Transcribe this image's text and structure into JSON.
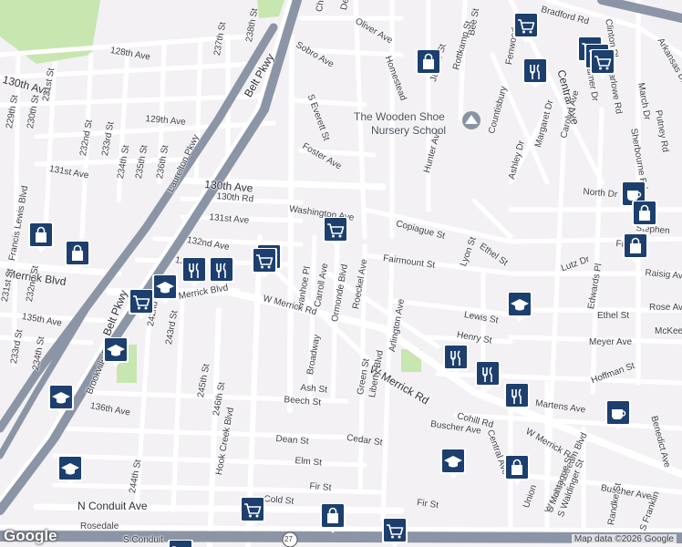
{
  "map": {
    "attribution": "Map data ©2026 Google",
    "logo_text": "Google",
    "route_shield": "27",
    "colors": {
      "bg": "#f3f1f4",
      "highway": "#8c95a5",
      "road": "#ffffff",
      "park": "#c8e6b0",
      "pin": "#1c3f6e"
    }
  },
  "streets": [
    {
      "text": "Charles"
    },
    {
      "text": "Dewitt St"
    },
    {
      "text": "Oliver Ave"
    },
    {
      "text": "Bee St"
    },
    {
      "text": "Bradford Rd"
    },
    {
      "text": "Clinton Pl"
    },
    {
      "text": "Fenwood"
    },
    {
      "text": "Sobro Ave"
    },
    {
      "text": "Homestead"
    },
    {
      "text": "Jasper St"
    },
    {
      "text": "Rottkamp St"
    },
    {
      "text": "Central Ave"
    },
    {
      "text": "Warner Dr"
    },
    {
      "text": "Barlowe Rd"
    },
    {
      "text": "March Dr"
    },
    {
      "text": "Putney Rd"
    },
    {
      "text": "Arkansas Dr"
    },
    {
      "text": "128th Ave"
    },
    {
      "text": "237th St"
    },
    {
      "text": "238th St"
    },
    {
      "text": "130th Ave"
    },
    {
      "text": "129th Ave"
    },
    {
      "text": "S Everett St"
    },
    {
      "text": "Belt Pkwy"
    },
    {
      "text": "Laurelton Pkwy"
    },
    {
      "text": "229th St"
    },
    {
      "text": "230th St"
    },
    {
      "text": "231st St"
    },
    {
      "text": "232nd St"
    },
    {
      "text": "233rd St"
    },
    {
      "text": "234th St"
    },
    {
      "text": "235th St"
    },
    {
      "text": "236th St"
    },
    {
      "text": "131st Ave"
    },
    {
      "text": "Francis Lewis Blvd"
    },
    {
      "text": "Foster Ave"
    },
    {
      "text": "Countisbury"
    },
    {
      "text": "Margaret Dr"
    },
    {
      "text": "Carolyn Ave"
    },
    {
      "text": "Sherbourne Rd"
    },
    {
      "text": "Ashley Dr"
    },
    {
      "text": "Hunter Ave"
    },
    {
      "text": "130th Ave"
    },
    {
      "text": "130th Rd"
    },
    {
      "text": "131st Ave"
    },
    {
      "text": "Washington Ave"
    },
    {
      "text": "North Dr"
    },
    {
      "text": "Copiague St"
    },
    {
      "text": "Stephen"
    },
    {
      "text": "Fritchie"
    },
    {
      "text": "132nd Ave"
    },
    {
      "text": "133rd"
    },
    {
      "text": "Merrick Blvd"
    },
    {
      "text": "Fairmount St"
    },
    {
      "text": "Lyon St"
    },
    {
      "text": "Ethel St"
    },
    {
      "text": "Lutz Dr"
    },
    {
      "text": "Raisig Ave"
    },
    {
      "text": "231st St"
    },
    {
      "text": "232nd St"
    },
    {
      "text": "Belt Pkwy"
    },
    {
      "text": "Ivanhoe Pl"
    },
    {
      "text": "Carroll Ave"
    },
    {
      "text": "Ormonde Blvd"
    },
    {
      "text": "Roeckel Ave"
    },
    {
      "text": "Arlington Ave"
    },
    {
      "text": "Edwards Pl"
    },
    {
      "text": "Rose Ave"
    },
    {
      "text": "Merrick Blvd"
    },
    {
      "text": "W Merrick Rd"
    },
    {
      "text": "135th Ave"
    },
    {
      "text": "242nd St"
    },
    {
      "text": "243rd St"
    },
    {
      "text": "Lewis St"
    },
    {
      "text": "Ethel St"
    },
    {
      "text": "McKee"
    },
    {
      "text": "233rd St"
    },
    {
      "text": "234th St"
    },
    {
      "text": "Brookville Blvd"
    },
    {
      "text": "Henry St"
    },
    {
      "text": "Meyer Ave"
    },
    {
      "text": "245th St"
    },
    {
      "text": "Broadway"
    },
    {
      "text": "W Merrick Rd"
    },
    {
      "text": "Liberty Blvd"
    },
    {
      "text": "Green St"
    },
    {
      "text": "Ash St"
    },
    {
      "text": "Hoffman St"
    },
    {
      "text": "136th Ave"
    },
    {
      "text": "246th St"
    },
    {
      "text": "Hook Creek Blvd"
    },
    {
      "text": "Beech St"
    },
    {
      "text": "Martens Ave"
    },
    {
      "text": "Benedict Ave"
    },
    {
      "text": "Cohill Rd"
    },
    {
      "text": "W Merrick Rd"
    },
    {
      "text": "Buscher Ave"
    },
    {
      "text": "Central Ave"
    },
    {
      "text": "Dean St"
    },
    {
      "text": "Cedar St"
    },
    {
      "text": "Elm St"
    },
    {
      "text": "244th St"
    },
    {
      "text": "Fir St"
    },
    {
      "text": "W Valley Stream Blvd"
    },
    {
      "text": "S Montague St"
    },
    {
      "text": "S Waldinger St"
    },
    {
      "text": "Buscher Ave"
    },
    {
      "text": "N Conduit Ave"
    },
    {
      "text": "Cold St"
    },
    {
      "text": "Fir St"
    },
    {
      "text": "S Conduit"
    },
    {
      "text": "Rosedale"
    },
    {
      "text": "Randke St"
    },
    {
      "text": "S Franklin"
    },
    {
      "text": "Union"
    }
  ],
  "poi": {
    "label_line1": "The Wooden Shoe",
    "label_line2": "Nursery School"
  },
  "pins": [
    {
      "kind": "shopping"
    },
    {
      "kind": "grocery"
    },
    {
      "kind": "grocery"
    },
    {
      "kind": "restaurant"
    },
    {
      "kind": "grocery"
    },
    {
      "kind": "grocery"
    },
    {
      "kind": "grocery"
    },
    {
      "kind": "cafe"
    },
    {
      "kind": "shopping"
    },
    {
      "kind": "shopping"
    },
    {
      "kind": "shopping"
    },
    {
      "kind": "shopping"
    },
    {
      "kind": "grocery"
    },
    {
      "kind": "restaurant"
    },
    {
      "kind": "restaurant"
    },
    {
      "kind": "school"
    },
    {
      "kind": "grocery"
    },
    {
      "kind": "grocery"
    },
    {
      "kind": "school"
    },
    {
      "kind": "school"
    },
    {
      "kind": "school"
    },
    {
      "kind": "school"
    },
    {
      "kind": "restaurant"
    },
    {
      "kind": "restaurant"
    },
    {
      "kind": "restaurant"
    },
    {
      "kind": "cafe"
    },
    {
      "kind": "school"
    },
    {
      "kind": "shopping"
    },
    {
      "kind": "grocery"
    },
    {
      "kind": "shopping"
    },
    {
      "kind": "grocery"
    },
    {
      "kind": "grocery"
    }
  ]
}
